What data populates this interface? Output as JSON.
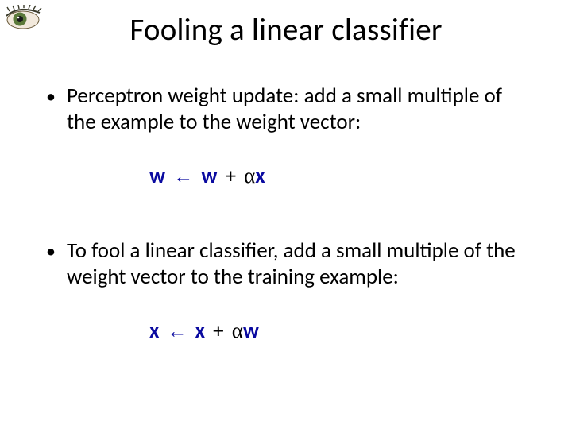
{
  "title": "Fooling a linear classifier",
  "bullets": [
    "Perceptron weight update: add a small multiple of the example to the weight vector:",
    "To fool a linear classifier, add a small multiple of the weight vector to the training example:"
  ],
  "eq1": {
    "lhs": "w",
    "arrow": "←",
    "rhs1": "w",
    "plus": "+",
    "alpha": "α",
    "rhs2": "x"
  },
  "eq2": {
    "lhs": "x",
    "arrow": "←",
    "rhs1": "x",
    "plus": "+",
    "alpha": "α",
    "rhs2": "w"
  }
}
